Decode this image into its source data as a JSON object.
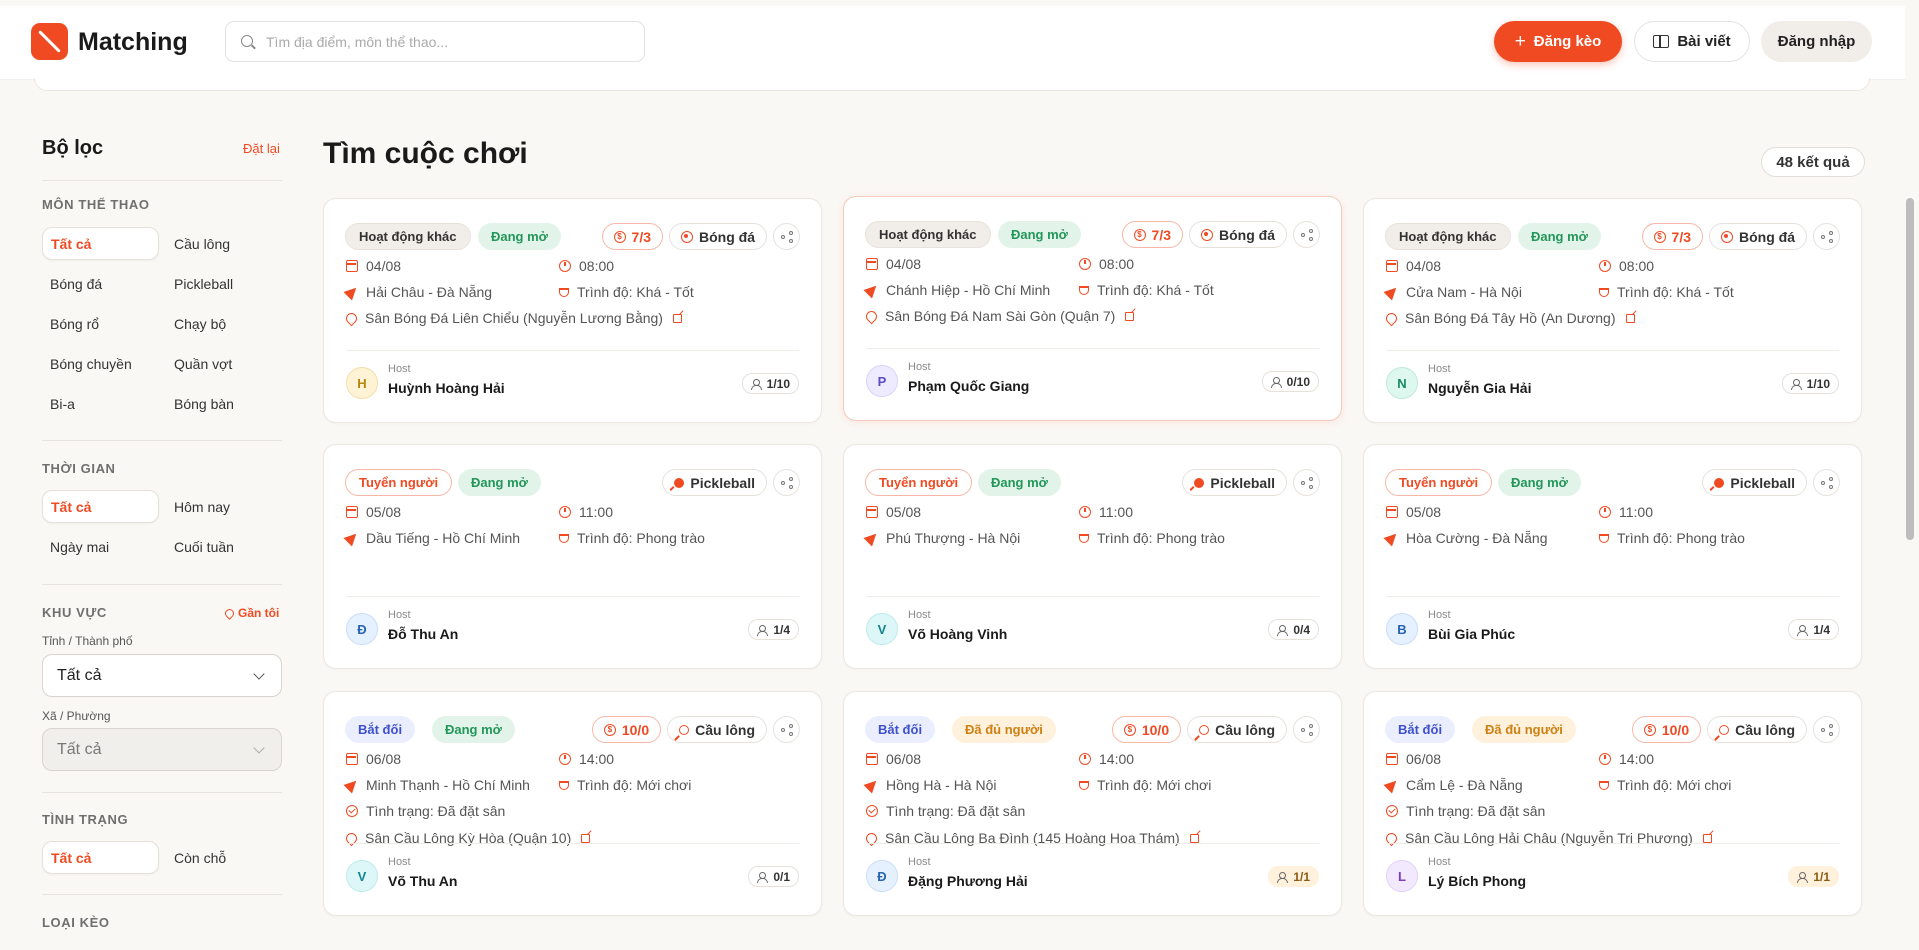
{
  "header": {
    "brand": "Matching",
    "search_placeholder": "Tìm địa điểm, môn thể thao...",
    "post_button": "Đăng kèo",
    "articles_button": "Bài viết",
    "login_button": "Đăng nhập"
  },
  "sidebar": {
    "title": "Bộ lọc",
    "reset": "Đặt lại",
    "sport": {
      "heading": "MÔN THỂ THAO",
      "options": [
        "Tất cả",
        "Cầu lông",
        "Bóng đá",
        "Pickleball",
        "Bóng rổ",
        "Chạy bộ",
        "Bóng chuyền",
        "Quần vợt",
        "Bi-a",
        "Bóng bàn"
      ],
      "selected": "Tất cả"
    },
    "time": {
      "heading": "THỜI GIAN",
      "options": [
        "Tất cả",
        "Hôm nay",
        "Ngày mai",
        "Cuối tuần"
      ],
      "selected": "Tất cả"
    },
    "area": {
      "heading": "KHU VỰC",
      "near_me": "Gần tôi",
      "province_label": "Tỉnh / Thành phố",
      "province_value": "Tất cả",
      "ward_label": "Xã / Phường",
      "ward_value": "Tất cả"
    },
    "status": {
      "heading": "TÌNH TRẠNG",
      "options": [
        "Tất cả",
        "Còn chỗ"
      ],
      "selected": "Tất cả"
    },
    "type_heading": "LOẠI KÈO"
  },
  "main": {
    "title": "Tìm cuộc chơi",
    "result_count": "48 kết quả"
  },
  "cards": [
    {
      "type": "Hoạt động khác",
      "status": "Đang mở",
      "price": "7/3",
      "sport": "Bóng đá",
      "date": "04/08",
      "time": "08:00",
      "location": "Hải Châu - Đà Nẵng",
      "level": "Trình độ: Khá - Tốt",
      "venue": "Sân Bóng Đá Liên Chiểu (Nguyễn Lương Bằng)",
      "host_label": "Host",
      "host_initial": "H",
      "host_name": "Huỳnh Hoàng Hải",
      "count": "1/10"
    },
    {
      "type": "Hoạt động khác",
      "status": "Đang mở",
      "price": "7/3",
      "sport": "Bóng đá",
      "date": "04/08",
      "time": "08:00",
      "location": "Chánh Hiệp - Hồ Chí Minh",
      "level": "Trình độ: Khá - Tốt",
      "venue": "Sân Bóng Đá Nam Sài Gòn (Quận 7)",
      "host_label": "Host",
      "host_initial": "P",
      "host_name": "Phạm Quốc Giang",
      "count": "0/10"
    },
    {
      "type": "Hoạt động khác",
      "status": "Đang mở",
      "price": "7/3",
      "sport": "Bóng đá",
      "date": "04/08",
      "time": "08:00",
      "location": "Cửa Nam - Hà Nội",
      "level": "Trình độ: Khá - Tốt",
      "venue": "Sân Bóng Đá Tây Hồ (An Dương)",
      "host_label": "Host",
      "host_initial": "N",
      "host_name": "Nguyễn Gia Hải",
      "count": "1/10"
    },
    {
      "type": "Tuyển người",
      "status": "Đang mở",
      "sport": "Pickleball",
      "date": "05/08",
      "time": "11:00",
      "location": "Dầu Tiếng - Hồ Chí Minh",
      "level": "Trình độ: Phong trào",
      "host_label": "Host",
      "host_initial": "Đ",
      "host_name": "Đỗ Thu An",
      "count": "1/4"
    },
    {
      "type": "Tuyển người",
      "status": "Đang mở",
      "sport": "Pickleball",
      "date": "05/08",
      "time": "11:00",
      "location": "Phú Thượng - Hà Nội",
      "level": "Trình độ: Phong trào",
      "host_label": "Host",
      "host_initial": "V",
      "host_name": "Võ Hoàng Vinh",
      "count": "0/4"
    },
    {
      "type": "Tuyển người",
      "status": "Đang mở",
      "sport": "Pickleball",
      "date": "05/08",
      "time": "11:00",
      "location": "Hòa Cường - Đà Nẵng",
      "level": "Trình độ: Phong trào",
      "host_label": "Host",
      "host_initial": "B",
      "host_name": "Bùi Gia Phúc",
      "count": "1/4"
    },
    {
      "type": "Bắt đối",
      "status": "Đang mở",
      "price": "10/0",
      "sport": "Cầu lông",
      "date": "06/08",
      "time": "14:00",
      "location": "Minh Thạnh - Hồ Chí Minh",
      "level": "Trình độ: Mới chơi",
      "booking": "Tình trạng: Đã đặt sân",
      "venue": "Sân Cầu Lông Kỳ Hòa (Quận 10)",
      "host_label": "Host",
      "host_initial": "V",
      "host_name": "Võ Thu An",
      "count": "0/1"
    },
    {
      "type": "Bắt đối",
      "status": "Đã đủ người",
      "price": "10/0",
      "sport": "Cầu lông",
      "date": "06/08",
      "time": "14:00",
      "location": "Hồng Hà - Hà Nội",
      "level": "Trình độ: Mới chơi",
      "booking": "Tình trạng: Đã đặt sân",
      "venue": "Sân Cầu Lông Ba Đình (145 Hoàng Hoa Thám)",
      "host_label": "Host",
      "host_initial": "Đ",
      "host_name": "Đặng Phương Hải",
      "count": "1/1"
    },
    {
      "type": "Bắt đối",
      "status": "Đã đủ người",
      "price": "10/0",
      "sport": "Cầu lông",
      "date": "06/08",
      "time": "14:00",
      "location": "Cẩm Lệ - Đà Nẵng",
      "level": "Trình độ: Mới chơi",
      "booking": "Tình trạng: Đã đặt sân",
      "venue": "Sân Cầu Lông Hải Châu (Nguyễn Tri Phương)",
      "host_label": "Host",
      "host_initial": "L",
      "host_name": "Lý Bích Phong",
      "count": "1/1"
    }
  ],
  "colors": {
    "accent": "#f04a23",
    "open": "#23965a",
    "full": "#cf8013",
    "duel": "#3f51c9"
  }
}
